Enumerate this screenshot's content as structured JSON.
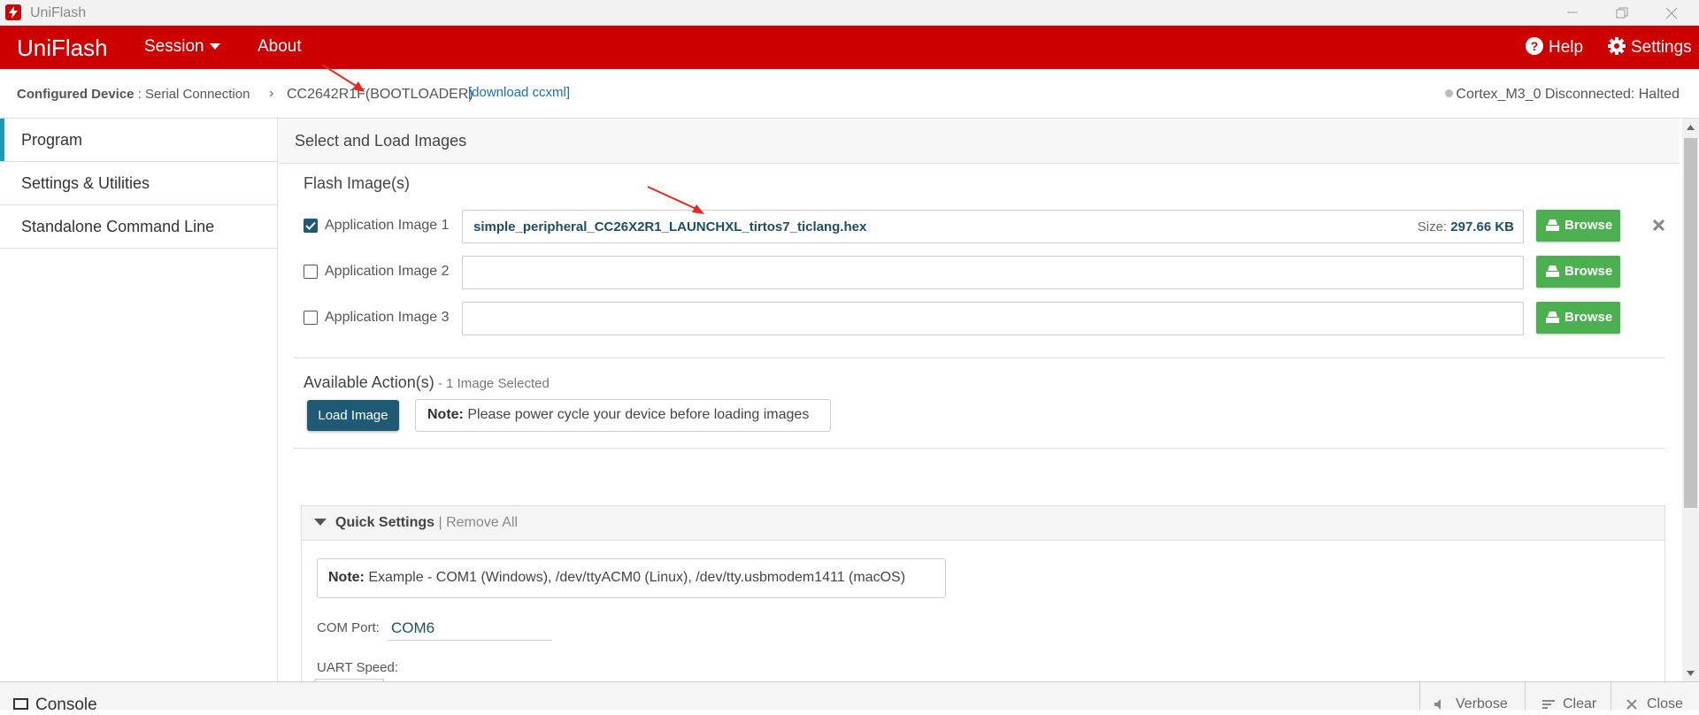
{
  "window": {
    "title": "UniFlash"
  },
  "navbar": {
    "brand": "UniFlash",
    "menu": [
      "Session",
      "About"
    ],
    "help": "Help",
    "settings": "Settings"
  },
  "device": {
    "label": "Configured Device",
    "connection": " : Serial Connection",
    "name": "CC2642R1F(BOOTLOADER)",
    "download_link": "[download ccxml]",
    "status": "Cortex_M3_0 Disconnected: Halted"
  },
  "sidebar": {
    "items": [
      "Program",
      "Settings & Utilities",
      "Standalone Command Line"
    ]
  },
  "main": {
    "header": "Select and Load Images",
    "flash_title": "Flash Image(s)",
    "images": [
      {
        "label": "Application Image 1",
        "checked": true,
        "file": "simple_peripheral_CC26X2R1_LAUNCHXL_tirtos7_ticlang.hex",
        "size_label": "Size:",
        "size": "297.66 KB"
      },
      {
        "label": "Application Image 2",
        "checked": false,
        "file": "",
        "size_label": "",
        "size": ""
      },
      {
        "label": "Application Image 3",
        "checked": false,
        "file": "",
        "size_label": "",
        "size": ""
      }
    ],
    "browse_label": "Browse",
    "actions_title": "Available Action(s)",
    "actions_sub": " - 1 Image Selected",
    "load_button": "Load Image",
    "load_note_bold": "Note:",
    "load_note_text": " Please power cycle your device before loading images"
  },
  "quick_settings": {
    "title": "Quick Settings",
    "separator": " | ",
    "remove_all": "Remove All",
    "note_bold": "Note:",
    "note_text": " Example - COM1 (Windows), /dev/ttyACM0 (Linux), /dev/tty.usbmodem1411 (macOS)",
    "com_port_label": "COM Port:",
    "com_port_value": "COM6",
    "uart_label": "UART Speed:"
  },
  "console": {
    "title": "Console",
    "verbose": "Verbose",
    "clear": "Clear",
    "close": "Close"
  },
  "colors": {
    "brand_red": "#cc0000",
    "accent_teal": "#1e5a73",
    "browse_green": "#4caf50",
    "annotation_arrow": "#e8281e"
  }
}
